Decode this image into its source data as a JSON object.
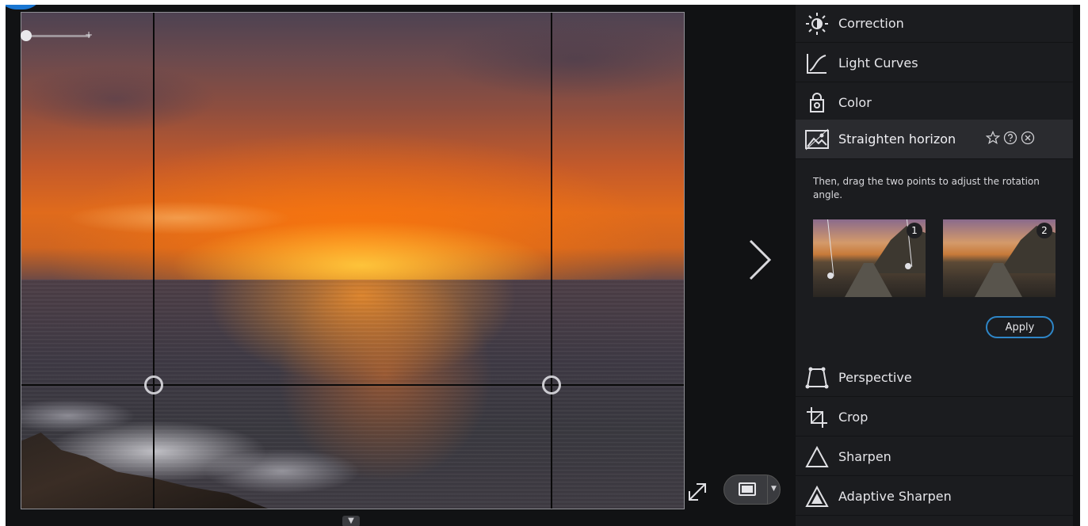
{
  "colors": {
    "panel_bg": "#1b1c1f",
    "active_item_bg": "#2a2b2f",
    "accent": "#2e86c8",
    "app_bg": "#111214"
  },
  "panel": {
    "items_top": [
      {
        "label": "Correction",
        "icon": "sun-brightness-icon"
      },
      {
        "label": "Light Curves",
        "icon": "curve-icon"
      },
      {
        "label": "Color",
        "icon": "color-bag-icon"
      }
    ],
    "active": {
      "label": "Straighten horizon",
      "icon": "horizon-image-icon",
      "actions": [
        "star-icon",
        "help-icon",
        "close-circle-icon"
      ],
      "instruction": "Then, drag the two points to adjust the rotation angle.",
      "thumbs": [
        {
          "number": "1"
        },
        {
          "number": "2"
        }
      ],
      "apply_label": "Apply"
    },
    "items_bottom": [
      {
        "label": "Perspective",
        "icon": "perspective-icon"
      },
      {
        "label": "Crop",
        "icon": "crop-icon"
      },
      {
        "label": "Sharpen",
        "icon": "triangle-outline-icon"
      },
      {
        "label": "Adaptive Sharpen",
        "icon": "triangle-filled-icon"
      }
    ]
  },
  "zoom": {
    "plus_label": "+"
  }
}
